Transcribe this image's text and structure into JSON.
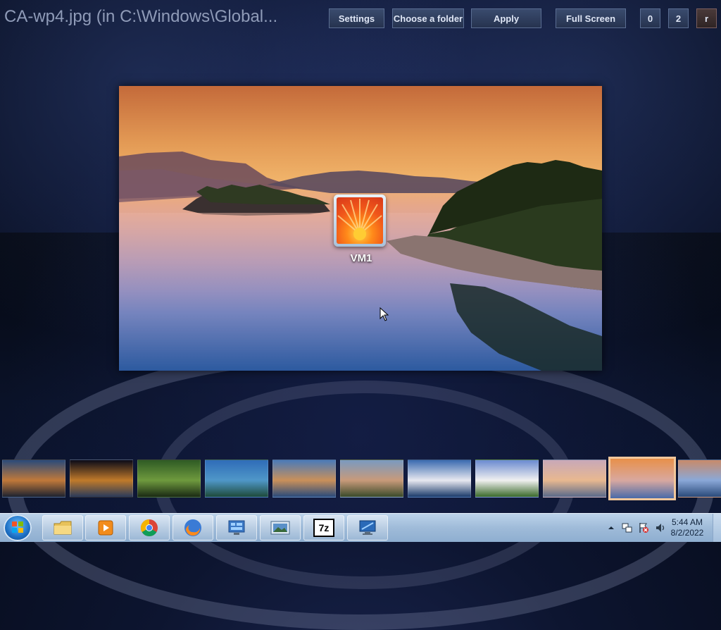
{
  "window": {
    "title": "CA-wp4.jpg (in C:\\Windows\\Global..."
  },
  "toolbar": {
    "settings_label": "Settings",
    "choose_folder_label": "Choose a folder",
    "apply_label": "Apply",
    "fullscreen_label": "Full Screen",
    "btn_0_label": "0",
    "btn_2_label": "2",
    "btn_r_label": "r"
  },
  "preview": {
    "user_name": "VM1"
  },
  "thumbnails": [
    {
      "name": "thumb-baobab-sunset",
      "colors": [
        "#2a4a7a",
        "#c0793a",
        "#1c2230"
      ]
    },
    {
      "name": "thumb-fireworks-city",
      "colors": [
        "#0a0a18",
        "#c07a2a",
        "#2a3a5a"
      ]
    },
    {
      "name": "thumb-rainforest-waterfall",
      "colors": [
        "#2e5a24",
        "#6f9a3e",
        "#1a2a14"
      ]
    },
    {
      "name": "thumb-sydney-harbour",
      "colors": [
        "#2f6cb8",
        "#4f97c8",
        "#1e4a3a"
      ]
    },
    {
      "name": "thumb-twelve-apostles",
      "colors": [
        "#4a7ab8",
        "#c9905a",
        "#2a4a7a"
      ]
    },
    {
      "name": "thumb-canyon-river",
      "colors": [
        "#7a9ac0",
        "#c89a7a",
        "#3a4a2a"
      ]
    },
    {
      "name": "thumb-mountain-lake",
      "colors": [
        "#3a6ab0",
        "#e8e8f0",
        "#1a3a6a"
      ]
    },
    {
      "name": "thumb-alpine-meadow",
      "colors": [
        "#6a8ad0",
        "#f0f0f0",
        "#3a6a2a"
      ]
    },
    {
      "name": "thumb-lighthouse-coast",
      "colors": [
        "#c8a8b8",
        "#e8b890",
        "#5a6a8a"
      ]
    },
    {
      "name": "thumb-lake-sunset",
      "colors": [
        "#e8904a",
        "#d8a8a0",
        "#4a6aa8"
      ]
    },
    {
      "name": "thumb-lake-dusk",
      "colors": [
        "#c88a6a",
        "#8aa8d8",
        "#2a4a7a"
      ]
    }
  ],
  "selected_thumbnail_index": 9,
  "taskbar": {
    "apps": [
      {
        "name": "file-explorer-icon"
      },
      {
        "name": "media-player-icon"
      },
      {
        "name": "chrome-icon"
      },
      {
        "name": "firefox-icon"
      },
      {
        "name": "control-panel-icon"
      },
      {
        "name": "photo-viewer-icon"
      },
      {
        "name": "7zip-icon"
      },
      {
        "name": "remote-desktop-icon"
      }
    ],
    "sevenzip_label": "7z",
    "time": "5:44 AM",
    "date": "8/2/2022"
  },
  "colors": {
    "accent_selected": "#f1c79b",
    "toolbar_button": "#2f3e5e"
  }
}
